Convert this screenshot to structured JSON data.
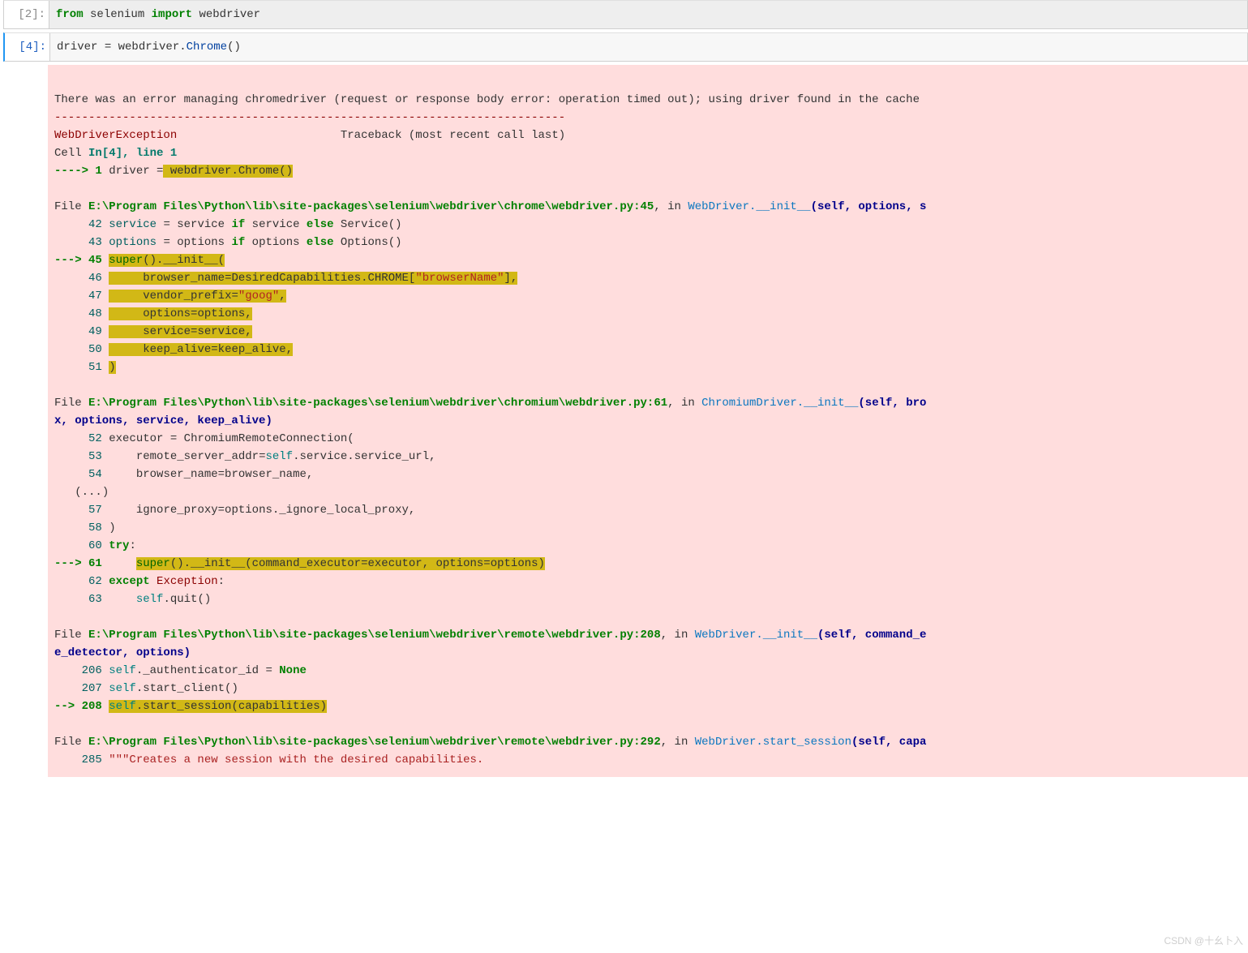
{
  "cells": {
    "c1": {
      "prompt": "[2]:",
      "code_tokens": {
        "kw_from": "from",
        "mod": "selenium",
        "kw_import": "import",
        "name": "webdriver"
      }
    },
    "c2": {
      "prompt": "[4]:",
      "code_tokens": {
        "lhs": "driver ",
        "eq": "=",
        "mod": " webdriver",
        "dot": ".",
        "cls": "Chrome",
        "paren": "()"
      }
    }
  },
  "err": {
    "stdout_line": "There was an error managing chromedriver (request or response body error: operation timed out); using driver found in the cache",
    "dashes": "---------------------------------------------------------------------------",
    "exc_name": "WebDriverException",
    "traceback_label": "Traceback (most recent call last)",
    "cell_ref": "Cell ",
    "in_ref": "In[4], line 1",
    "arrow1": "----> 1 ",
    "line1_a": "driver ",
    "line1_eq": "=",
    "line1_hl": " webdriver.Chrome()",
    "frame1": {
      "file_pre": "File ",
      "file": "E:\\Program Files\\Python\\lib\\site-packages\\selenium\\webdriver\\chrome\\webdriver.py:45",
      "in": ", in ",
      "fn": "WebDriver.__init__",
      "sig": "(self, options, s",
      "l42": "     42 service ",
      "eq42": "=",
      "r42a": " service ",
      "if42": "if",
      "r42b": " service ",
      "else42": "else",
      "r42c": " Service()",
      "l43": "     43 options ",
      "eq43": "=",
      "r43a": " options ",
      "if43": "if",
      "r43b": " options ",
      "else43": "else",
      "r43c": " Options()",
      "arrow45": "---> 45 ",
      "super45": "super",
      "init45": "().__init__(",
      "l46n": "     46 ",
      "l46": "    browser_name=DesiredCapabilities.CHROME[",
      "l46s": "\"browserName\"",
      "l46t": "],",
      "l47n": "     47 ",
      "l47": "    vendor_prefix=",
      "l47s": "\"goog\"",
      "l47t": ",",
      "l48n": "     48 ",
      "l48": "    options=options,",
      "l49n": "     49 ",
      "l49": "    service=service,",
      "l50n": "     50 ",
      "l50": "    keep_alive=keep_alive,",
      "l51n": "     51 ",
      "l51": ")"
    },
    "frame2": {
      "file_pre": "File ",
      "file": "E:\\Program Files\\Python\\lib\\site-packages\\selenium\\webdriver\\chromium\\webdriver.py:61",
      "in": ", in ",
      "fn": "ChromiumDriver.__init__",
      "sig": "(self, bro",
      "sig_cont": "x, options, service, keep_alive)",
      "l52n": "     52 ",
      "l52a": "executor ",
      "eq52": "=",
      "l52b": " ChromiumRemoteConnection(",
      "l53n": "     53 ",
      "l53": "    remote_server_addr=",
      "l53self": "self",
      "l53b": ".service.service_url,",
      "l54n": "     54 ",
      "l54": "    browser_name=browser_name,",
      "ellips": "   (...)",
      "l57n": "     57 ",
      "l57": "    ignore_proxy=options._ignore_local_proxy,",
      "l58n": "     58 ",
      "l58": ")",
      "l60n": "     60 ",
      "try60": "try",
      "colon60": ":",
      "arrow61": "---> 61 ",
      "l61pad": "    ",
      "super61": "super",
      "init61": "().__init__(command_executor=executor, options=options)",
      "l62n": "     62 ",
      "except62": "except",
      "exc62": " Exception",
      "col62": ":",
      "l63n": "     63 ",
      "l63": "    ",
      "self63": "self",
      "l63b": ".quit()"
    },
    "frame3": {
      "file_pre": "File ",
      "file": "E:\\Program Files\\Python\\lib\\site-packages\\selenium\\webdriver\\remote\\webdriver.py:208",
      "in": ", in ",
      "fn": "WebDriver.__init__",
      "sig": "(self, command_e",
      "sig_cont": "e_detector, options)",
      "l206n": "    206 ",
      "self206": "self",
      "l206a": "._authenticator_id ",
      "eq206": "=",
      "none206": " None",
      "l207n": "    207 ",
      "self207": "self",
      "l207": ".start_client()",
      "arrow208": "--> 208 ",
      "self208": "self",
      "l208": ".start_session(capabilities)"
    },
    "frame4": {
      "file_pre": "File ",
      "file": "E:\\Program Files\\Python\\lib\\site-packages\\selenium\\webdriver\\remote\\webdriver.py:292",
      "in": ", in ",
      "fn": "WebDriver.start_session",
      "sig": "(self, capa",
      "l285n": "    285 ",
      "doc": "\"\"\"Creates a new session with the desired capabilities."
    }
  },
  "watermark": "CSDN @十幺卜入"
}
